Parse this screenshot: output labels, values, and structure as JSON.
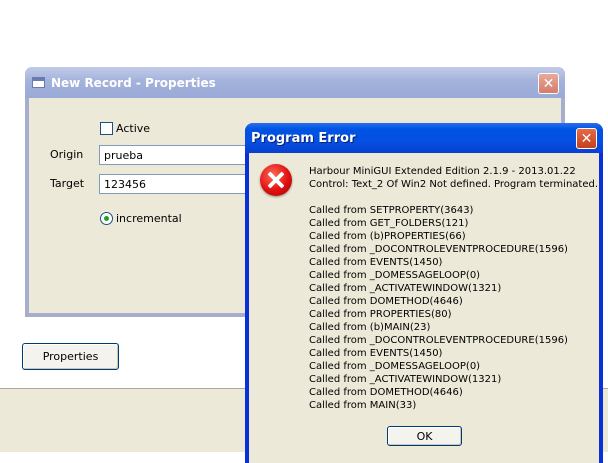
{
  "main_window": {
    "properties_button": "Properties"
  },
  "new_record_window": {
    "title": "New Record - Properties",
    "close_glyph": "✕",
    "active_label": "Active",
    "origin_label": "Origin",
    "origin_value": "prueba",
    "target_label": "Target",
    "target_value": "123456",
    "incremental_label": "incremental"
  },
  "error_window": {
    "title": "Program Error",
    "close_glyph": "✕",
    "icon": "error-x-icon",
    "header_lines": [
      "Harbour MiniGUI Extended Edition 2.1.9 - 2013.01.22",
      "Control: Text_2 Of Win2 Not defined. Program terminated."
    ],
    "call_stack": [
      "Called from SETPROPERTY(3643)",
      "Called from GET_FOLDERS(121)",
      "Called from (b)PROPERTIES(66)",
      "Called from _DOCONTROLEVENTPROCEDURE(1596)",
      "Called from EVENTS(1450)",
      "Called from _DOMESSAGELOOP(0)",
      "Called from _ACTIVATEWINDOW(1321)",
      "Called from DOMETHOD(4646)",
      "Called from PROPERTIES(80)",
      "Called from (b)MAIN(23)",
      "Called from _DOCONTROLEVENTPROCEDURE(1596)",
      "Called from EVENTS(1450)",
      "Called from _DOMESSAGELOOP(0)",
      "Called from _ACTIVATEWINDOW(1321)",
      "Called from DOMETHOD(4646)",
      "Called from MAIN(33)"
    ],
    "ok_button": "OK"
  },
  "colors": {
    "xp_blue": "#0054e3",
    "inactive_title": "#a4b2dc",
    "dialog_face": "#ece9d8",
    "close_red": "#c6401d"
  }
}
